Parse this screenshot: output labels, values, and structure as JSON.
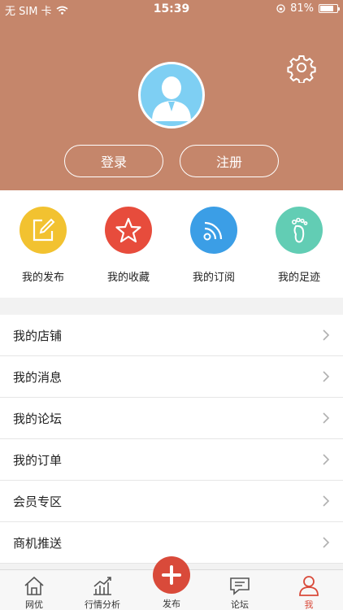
{
  "status_bar": {
    "carrier": "无 SIM 卡",
    "time": "15:39",
    "battery_percent": "81%",
    "battery_level": 0.81
  },
  "header": {
    "login_label": "登录",
    "register_label": "注册"
  },
  "quick_actions": [
    {
      "label": "我的发布",
      "icon": "edit-icon",
      "color": "#f2c230"
    },
    {
      "label": "我的收藏",
      "icon": "star-icon",
      "color": "#e74c3c"
    },
    {
      "label": "我的订阅",
      "icon": "rss-icon",
      "color": "#3b9ee6"
    },
    {
      "label": "我的足迹",
      "icon": "footprint-icon",
      "color": "#62cdb4"
    }
  ],
  "menu": [
    {
      "label": "我的店铺"
    },
    {
      "label": "我的消息"
    },
    {
      "label": "我的论坛"
    },
    {
      "label": "我的订单"
    },
    {
      "label": "会员专区"
    },
    {
      "label": "商机推送"
    }
  ],
  "tabs": [
    {
      "label": "网优",
      "icon": "home-icon"
    },
    {
      "label": "行情分析",
      "icon": "chart-icon"
    },
    {
      "label": "发布",
      "icon": "plus-icon"
    },
    {
      "label": "论坛",
      "icon": "chat-icon"
    },
    {
      "label": "我",
      "icon": "person-icon",
      "active": true
    }
  ],
  "colors": {
    "header_bg": "#c5866b",
    "accent": "#d94a3a"
  }
}
